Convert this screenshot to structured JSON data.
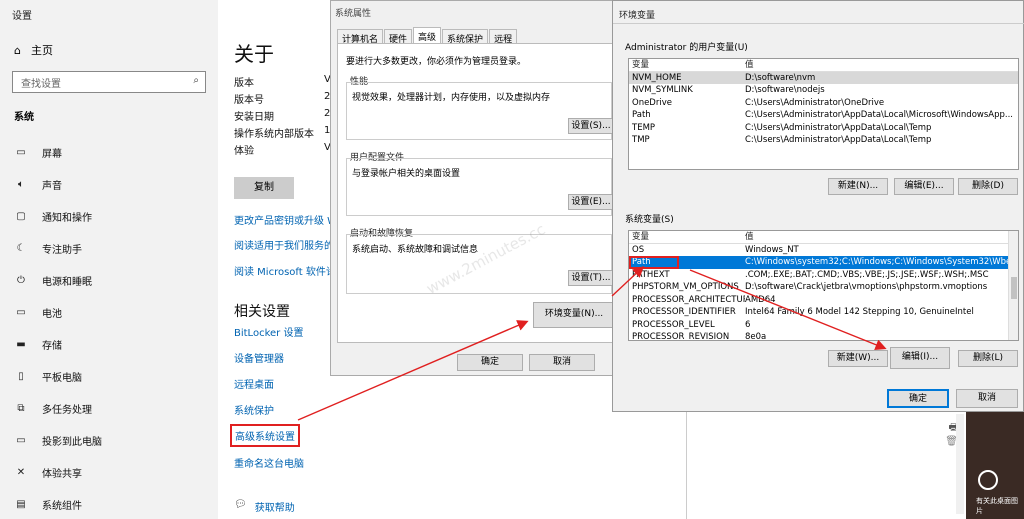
{
  "settings": {
    "title": "设置",
    "home": "主页",
    "search_placeholder": "查找设置",
    "section": "系统",
    "nav": [
      "屏幕",
      "声音",
      "通知和操作",
      "专注助手",
      "电源和睡眠",
      "电池",
      "存储",
      "平板电脑",
      "多任务处理",
      "投影到此电脑",
      "体验共享",
      "系统组件"
    ],
    "about_title": "关于",
    "specs": [
      [
        "版本",
        "V"
      ],
      [
        "版本号",
        "2"
      ],
      [
        "安装日期",
        "2"
      ],
      [
        "操作系统内部版本",
        "1"
      ],
      [
        "体验",
        "V"
      ]
    ],
    "copy": "复制",
    "links": [
      "更改产品密钥或升级 W",
      "阅读适用于我们服务的",
      "阅读 Microsoft 软件许"
    ],
    "related_title": "相关设置",
    "related": [
      "BitLocker 设置",
      "设备管理器",
      "远程桌面",
      "系统保护",
      "高级系统设置",
      "重命名这台电脑"
    ],
    "help": "获取帮助"
  },
  "sysprops": {
    "title": "系统属性",
    "tabs": [
      "计算机名",
      "硬件",
      "高级",
      "系统保护",
      "远程"
    ],
    "notice": "要进行大多数更改，你必须作为管理员登录。",
    "perf_label": "性能",
    "perf_desc": "视觉效果，处理器计划，内存使用，以及虚拟内存",
    "profile_label": "用户配置文件",
    "profile_desc": "与登录帐户相关的桌面设置",
    "startup_label": "启动和故障恢复",
    "startup_desc": "系统启动、系统故障和调试信息",
    "settings_btn": "设置(S)...",
    "settings_btn2": "设置(E)...",
    "settings_btn3": "设置(T)...",
    "env_btn": "环境变量(N)...",
    "ok": "确定",
    "cancel": "取消"
  },
  "envvars": {
    "title": "环境变量",
    "user_label": "Administrator 的用户变量(U)",
    "col_var": "变量",
    "col_val": "值",
    "user_vars": [
      [
        "NVM_HOME",
        "D:\\software\\nvm"
      ],
      [
        "NVM_SYMLINK",
        "D:\\software\\nodejs"
      ],
      [
        "OneDrive",
        "C:\\Users\\Administrator\\OneDrive"
      ],
      [
        "Path",
        "C:\\Users\\Administrator\\AppData\\Local\\Microsoft\\WindowsApp..."
      ],
      [
        "TEMP",
        "C:\\Users\\Administrator\\AppData\\Local\\Temp"
      ],
      [
        "TMP",
        "C:\\Users\\Administrator\\AppData\\Local\\Temp"
      ]
    ],
    "new_user": "新建(N)...",
    "edit_user": "编辑(E)...",
    "del_user": "删除(D)",
    "sys_label": "系统变量(S)",
    "sys_vars": [
      [
        "OS",
        "Windows_NT"
      ],
      [
        "Path",
        "C:\\Windows\\system32;C:\\Windows;C:\\Windows\\System32\\Wbe..."
      ],
      [
        "PATHEXT",
        ".COM;.EXE;.BAT;.CMD;.VBS;.VBE;.JS;.JSE;.WSF;.WSH;.MSC"
      ],
      [
        "PHPSTORM_VM_OPTIONS",
        "D:\\software\\Crack\\jetbra\\vmoptions\\phpstorm.vmoptions"
      ],
      [
        "PROCESSOR_ARCHITECTURE",
        "AMD64"
      ],
      [
        "PROCESSOR_IDENTIFIER",
        "Intel64 Family 6 Model 142 Stepping 10, GenuineIntel"
      ],
      [
        "PROCESSOR_LEVEL",
        "6"
      ],
      [
        "PROCESSOR_REVISION",
        "8e0a"
      ]
    ],
    "new_sys": "新建(W)...",
    "edit_sys": "编辑(I)...",
    "del_sys": "删除(L)",
    "ok": "确定",
    "cancel": "取消"
  },
  "watermark": "www.2minutes.cc",
  "desk_text": "有关此桌面图片"
}
